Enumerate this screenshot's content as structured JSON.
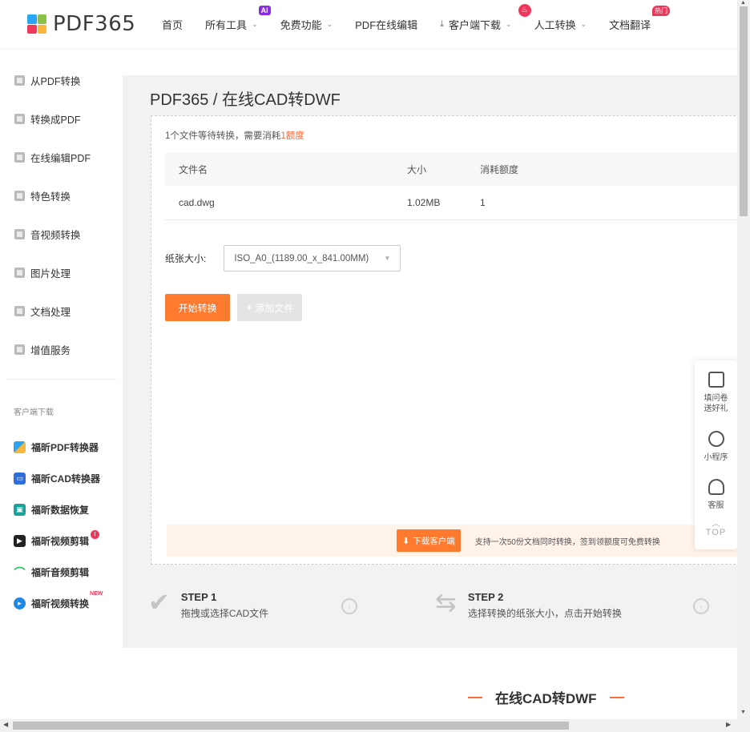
{
  "header": {
    "logo_text": "PDF365",
    "nav": [
      {
        "label": "首页"
      },
      {
        "label": "所有工具",
        "badge": "AI"
      },
      {
        "label": "免费功能"
      },
      {
        "label": "PDF在线编辑"
      },
      {
        "label": "客户端下载"
      },
      {
        "label": "人工转换"
      },
      {
        "label": "文档翻译",
        "badge": "热门"
      }
    ]
  },
  "sidebar": {
    "items": [
      {
        "label": "从PDF转换",
        "icon": "convert-from-pdf-icon"
      },
      {
        "label": "转换成PDF",
        "icon": "convert-to-pdf-icon"
      },
      {
        "label": "在线编辑PDF",
        "icon": "edit-pdf-icon"
      },
      {
        "label": "特色转换",
        "icon": "feature-icon"
      },
      {
        "label": "音视频转换",
        "icon": "video-icon"
      },
      {
        "label": "图片处理",
        "icon": "image-icon"
      },
      {
        "label": "文档处理",
        "icon": "document-icon"
      },
      {
        "label": "增值服务",
        "icon": "service-icon"
      }
    ],
    "client_title": "客户端下载",
    "apps": [
      {
        "label": "福昕PDF转换器",
        "color": "#4caf50"
      },
      {
        "label": "福昕CAD转换器",
        "color": "#2f6fdb"
      },
      {
        "label": "福昕数据恢复",
        "color": "#1aa39a"
      },
      {
        "label": "福昕视频剪辑",
        "color": "#222222"
      },
      {
        "label": "福昕音频剪辑",
        "color": "#1db954"
      },
      {
        "label": "福昕视频转换",
        "color": "#1e88e5",
        "badge": "NEW"
      }
    ]
  },
  "main": {
    "title": "PDF365 / 在线CAD转DWF",
    "info_prefix": "1个文件等待转换，需要消耗",
    "info_highlight": "1额度",
    "table": {
      "headers": [
        "文件名",
        "大小",
        "消耗额度"
      ],
      "rows": [
        {
          "name": "cad.dwg",
          "size": "1.02MB",
          "cost": "1"
        }
      ]
    },
    "paper_label": "纸张大小:",
    "paper_value": "ISO_A0_(1189.00_x_841.00MM)",
    "start_button": "开始转换",
    "add_button": "添加文件",
    "download_button": "下载客户端",
    "promo_text": "支持一次50份文档同时转换，签到领额度可免费转换",
    "steps": [
      {
        "title": "STEP 1",
        "desc": "拖拽或选择CAD文件"
      },
      {
        "title": "STEP 2",
        "desc": "选择转换的纸张大小，点击开始转换"
      }
    ],
    "section_title": "在线CAD转DWF"
  },
  "float_tools": {
    "survey": "填问卷送好礼",
    "miniapp": "小程序",
    "service": "客服",
    "top": "TOP"
  },
  "colors": {
    "accent": "#ff7a2f",
    "highlight": "#ff6a39",
    "hot": "#f0365a"
  }
}
